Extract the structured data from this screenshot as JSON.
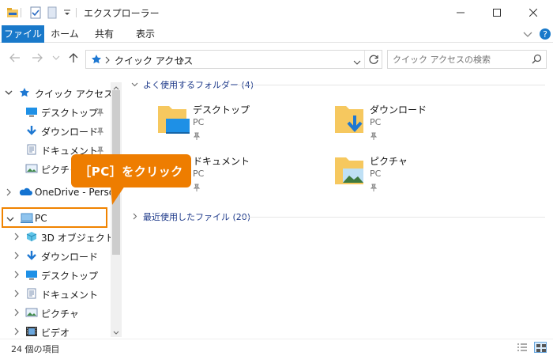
{
  "window": {
    "title": "エクスプローラー"
  },
  "ribbon": {
    "tabs": [
      "ファイル",
      "ホーム",
      "共有",
      "表示"
    ]
  },
  "address": {
    "path_label": "クイック アクセス",
    "search_placeholder": "クイック アクセスの検索"
  },
  "nav": {
    "items": [
      {
        "label": "クイック アクセス",
        "icon": "star-icon"
      },
      {
        "label": "デスクトップ",
        "icon": "desktop-icon"
      },
      {
        "label": "ダウンロード",
        "icon": "download-icon"
      },
      {
        "label": "ドキュメント",
        "icon": "document-icon"
      },
      {
        "label": "ピクチャ",
        "icon": "picture-icon"
      },
      {
        "label": "OneDrive - Person",
        "icon": "onedrive-icon"
      },
      {
        "label": "PC",
        "icon": "pc-icon"
      },
      {
        "label": "3D オブジェクト",
        "icon": "cube-icon"
      },
      {
        "label": "ダウンロード",
        "icon": "download-icon"
      },
      {
        "label": "デスクトップ",
        "icon": "desktop-icon"
      },
      {
        "label": "ドキュメント",
        "icon": "document-icon"
      },
      {
        "label": "ピクチャ",
        "icon": "picture-icon"
      },
      {
        "label": "ビデオ",
        "icon": "video-icon"
      }
    ]
  },
  "content": {
    "frequent_header": "よく使用するフォルダー (4)",
    "recent_header": "最近使用したファイル (20)",
    "folders": [
      {
        "name": "デスクトップ",
        "location": "PC"
      },
      {
        "name": "ダウンロード",
        "location": "PC"
      },
      {
        "name": "ドキュメント",
        "location": "PC"
      },
      {
        "name": "ピクチャ",
        "location": "PC"
      }
    ]
  },
  "status": {
    "item_count": "24 個の項目"
  },
  "callout": {
    "text": "［PC］をクリック"
  },
  "colors": {
    "accent": "#1979ca",
    "callout": "#ee7d00",
    "folder": "#f6c85f"
  }
}
